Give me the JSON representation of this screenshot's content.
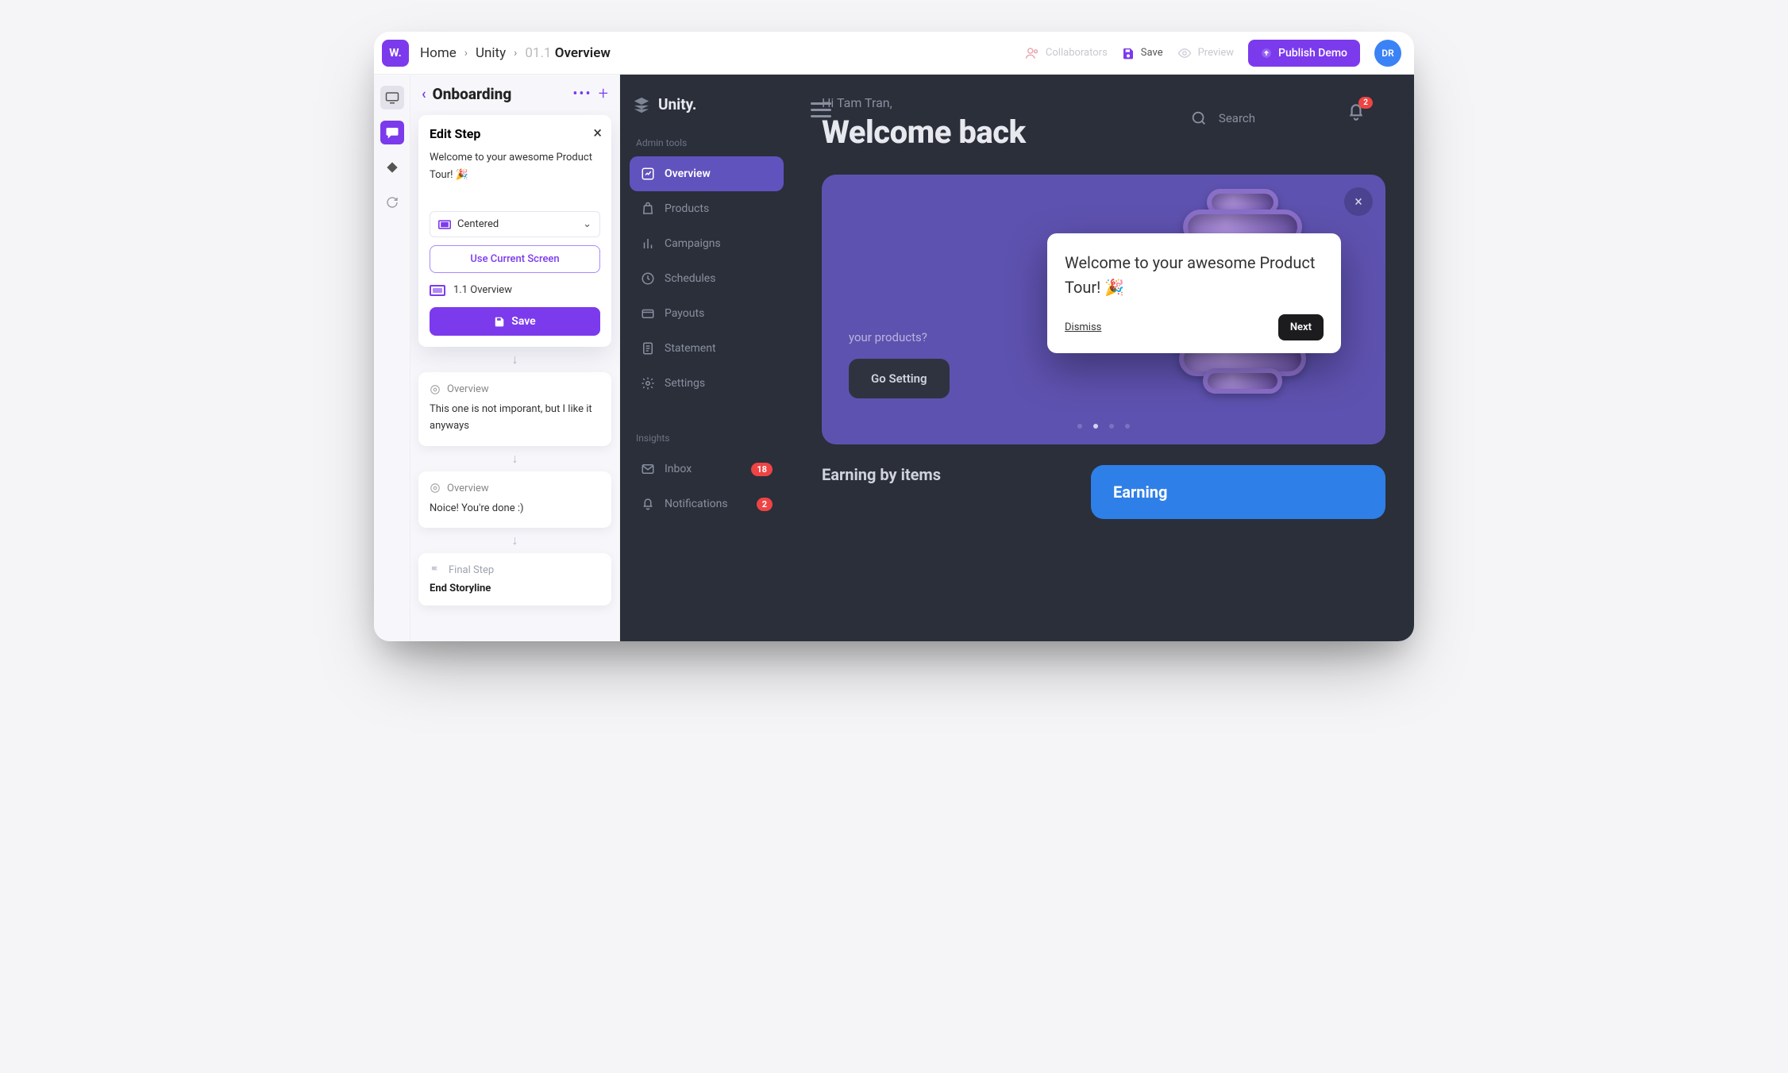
{
  "topbar": {
    "logo_text": "W.",
    "breadcrumb": {
      "item0": "Home",
      "item1": "Unity",
      "item2_prefix": "01.1",
      "item2_label": "Overview"
    },
    "collaborators": "Collaborators",
    "save": "Save",
    "preview": "Preview",
    "publish": "Publish Demo",
    "avatar": "DR"
  },
  "editor": {
    "title": "Onboarding",
    "edit_step_title": "Edit Step",
    "edit_text": "Welcome to your awesome Product Tour! 🎉",
    "position_label": "Centered",
    "use_current": "Use Current Screen",
    "screen_ref": "1.1 Overview",
    "save_label": "Save"
  },
  "steps": {
    "s1_title": "Overview",
    "s1_body": "This one is not imporant, but I like it anyways",
    "s2_title": "Overview",
    "s2_body": "Noice! You're done :)",
    "final_title": "Final Step",
    "final_body": "End Storyline"
  },
  "demo": {
    "brand": "Unity.",
    "admin_label": "Admin tools",
    "insights_label": "Insights",
    "nav": {
      "overview": "Overview",
      "products": "Products",
      "campaigns": "Campaigns",
      "schedules": "Schedules",
      "payouts": "Payouts",
      "statement": "Statement",
      "settings": "Settings",
      "inbox": "Inbox",
      "inbox_badge": "18",
      "notifications": "Notifications",
      "notifications_badge": "2"
    },
    "greet": "Hi Tam Tran,",
    "welcome": "Welcome back",
    "search": "Search",
    "bell_badge": "2",
    "hero_sub": "your products?",
    "go_setting": "Go Setting",
    "earning_title": "Earning by items",
    "earning_card": "Earning"
  },
  "tour": {
    "text": "Welcome to your awesome Product Tour! 🎉",
    "dismiss": "Dismiss",
    "next": "Next"
  }
}
